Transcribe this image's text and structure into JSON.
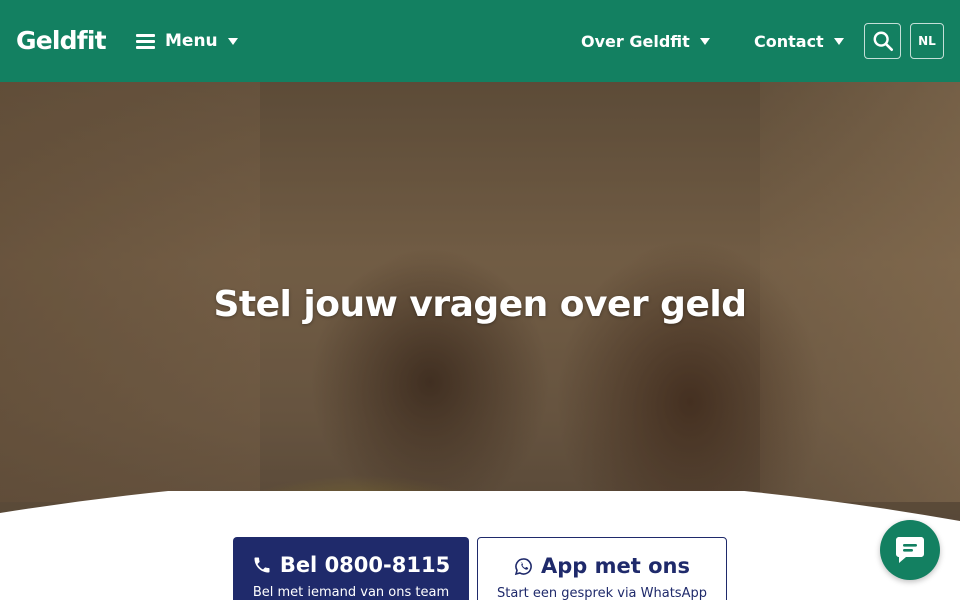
{
  "header": {
    "logo": "Geldfit",
    "menu_label": "Menu",
    "nav": [
      {
        "label": "Over Geldfit"
      },
      {
        "label": "Contact"
      }
    ],
    "language": "NL",
    "background_color": "#138061"
  },
  "hero": {
    "title": "Stel jouw vragen over geld"
  },
  "cta": {
    "call": {
      "title": "Bel 0800-8115",
      "subtitle": "Bel met iemand van ons team",
      "icon": "phone-icon"
    },
    "app": {
      "title": "App met ons",
      "subtitle": "Start een gesprek via WhatsApp",
      "icon": "whatsapp-icon"
    },
    "primary_color": "#1f2a6b"
  },
  "chat": {
    "icon": "chat-bubble-icon"
  }
}
